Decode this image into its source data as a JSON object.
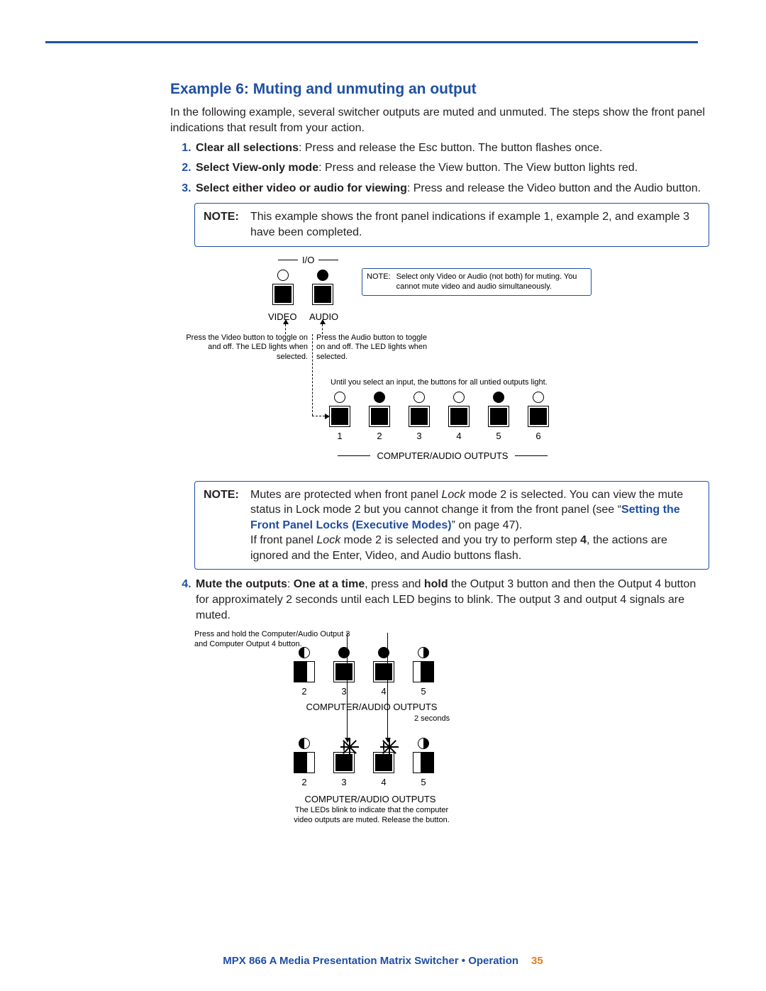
{
  "heading": "Example 6: Muting and unmuting an output",
  "intro": "In the following example, several switcher outputs are muted and unmuted. The steps show the front panel indications that result from your action.",
  "steps": [
    {
      "bold": "Clear all selections",
      "rest": ": Press and release the Esc button. The button flashes once."
    },
    {
      "bold": "Select View-only mode",
      "rest": ": Press and release the View button. The View button lights red."
    },
    {
      "bold": "Select either video or audio for viewing",
      "rest": ": Press and release the Video button and the Audio button."
    }
  ],
  "note1": {
    "label": "NOTE:",
    "text": "This example shows the front panel indications if example 1, example 2, and example 3 have been completed."
  },
  "d1": {
    "io": "I/O",
    "video": "VIDEO",
    "audio": "AUDIO",
    "videoCap": "Press the Video button to toggle on and off. The LED lights when selected.",
    "audioCap": "Press the Audio button to toggle on and off. The LED lights when selected.",
    "noteLabel": "NOTE:",
    "noteText": "Select only Video or Audio (not both) for muting. You cannot mute video and audio simultaneously.",
    "untied": "Until you select an input, the buttons for all untied outputs light.",
    "outs": [
      "1",
      "2",
      "3",
      "4",
      "5",
      "6"
    ],
    "outLabel": "COMPUTER/AUDIO OUTPUTS"
  },
  "note2": {
    "label": "NOTE:",
    "lock": "Lock",
    "p1a": "Mutes are protected when front panel ",
    "p1b": " mode 2 is selected.  You can view the mute status in Lock mode 2 but you cannot change it from the front panel (see “",
    "link": "Setting the Front Panel Locks (Executive Modes)",
    "p1c": "” on page 47).",
    "p2a": "If front panel ",
    "p2b": " mode 2 is selected and you try to perform step ",
    "four": "4",
    "p2c": ", the actions are ignored and the Enter, Video, and Audio buttons flash."
  },
  "step4": {
    "bold1": "Mute the outputs",
    "bold2": "One at a time",
    "mid1": ", press and ",
    "hold": "hold",
    "mid2": " the Output 3 button and then the Output 4 button for approximately 2 seconds until each LED begins to blink. The output 3 and output 4 signals are muted."
  },
  "d2": {
    "cap1": "Press and hold the Computer/Audio Output 3 and Computer Output 4 button.",
    "outs": [
      "2",
      "3",
      "4",
      "5"
    ],
    "outLabel": "COMPUTER/AUDIO OUTPUTS",
    "twoSec": "2 seconds",
    "cap2": "The LEDs blink to indicate that the computer video outputs are muted. Release the button."
  },
  "footer": {
    "text": "MPX 866 A Media Presentation Matrix Switcher • Operation",
    "page": "35"
  }
}
